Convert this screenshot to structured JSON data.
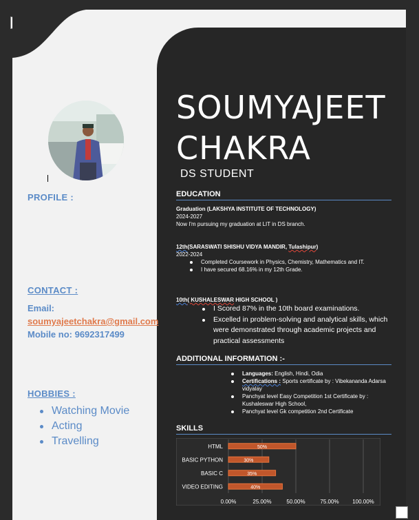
{
  "left": {
    "profile_heading": "PROFILE :",
    "contact_heading": "CONTACT :",
    "email_label": "Email:",
    "email_value": "soumyajeetchakra@gmail.com",
    "mobile": "Mobile no: 9692317499",
    "hobbies_heading": "HOBBIES :",
    "hobbies": [
      "Watching Movie",
      "Acting",
      "Travelling"
    ]
  },
  "header": {
    "first_name": "SOUMYAJEET",
    "last_name": "CHAKRA",
    "subtitle": "DS STUDENT"
  },
  "education": {
    "title": "EDUCATION",
    "grad": {
      "heading": "Graduation (LAKSHYA INSTITUTE OF TECHNOLOGY)",
      "years": "2024-2027",
      "desc": "Now I'm pursuing my graduation at LIT in DS branch."
    },
    "twelfth": {
      "heading_prefix": "12th",
      "heading_rest": "(SARASWATI SHISHU VIDYA MANDIR, ",
      "heading_place": "Tulashipur",
      "heading_end": ")",
      "years": "2022-2024",
      "bullets": [
        "Completed Coursework in Physics, Chemistry, Mathematics and IT.",
        "I have secured 68.16% in my 12th Grade."
      ]
    },
    "tenth": {
      "heading_prefix": "10th",
      "heading_place": "( KUSHALESWAR",
      "heading_rest": "  HIGH SCHOOL )",
      "bullets": [
        "I Scored 87% in the 10th board examinations.",
        "Excelled in problem-solving and analytical skills, which were demonstrated through academic projects and practical assessments"
      ]
    }
  },
  "additional": {
    "title": "ADDITIONAL INFORMATION :-",
    "items": [
      {
        "label": "Languages:",
        "text": " English, Hindi, Odia"
      },
      {
        "label": "Certifications :",
        "text": " Sports certificate by : Vibekananda Adarsa vidyalay"
      },
      {
        "label": "",
        "text": " Panchyat level Easy Competition 1st Certificate by : Kushaleswar High School,"
      },
      {
        "label": "",
        "text": "Panchyat level Gk competition 2nd Certificate"
      }
    ]
  },
  "skills": {
    "title": "SKILLS"
  },
  "chart_data": {
    "type": "bar",
    "orientation": "horizontal",
    "categories": [
      "HTML",
      "BASIC PYTHON",
      "BASIC C",
      "VIDEO EDITING"
    ],
    "values": [
      50,
      30,
      35,
      40
    ],
    "data_labels": [
      "50%",
      "30%",
      "35%",
      "40%"
    ],
    "x_ticks": [
      "0.00%",
      "25.00%",
      "50.00%",
      "75.00%",
      "100.00%"
    ],
    "xlim": [
      0,
      100
    ],
    "grid": true,
    "colors": {
      "bar": "#c0562b",
      "bar_edge": "#e8743c",
      "background": "#2b2b2b",
      "grid": "#555555",
      "text": "#ffffff"
    }
  },
  "colors": {
    "accent": "#5b8bc7",
    "email": "#e07a4c",
    "panel": "#262626"
  }
}
